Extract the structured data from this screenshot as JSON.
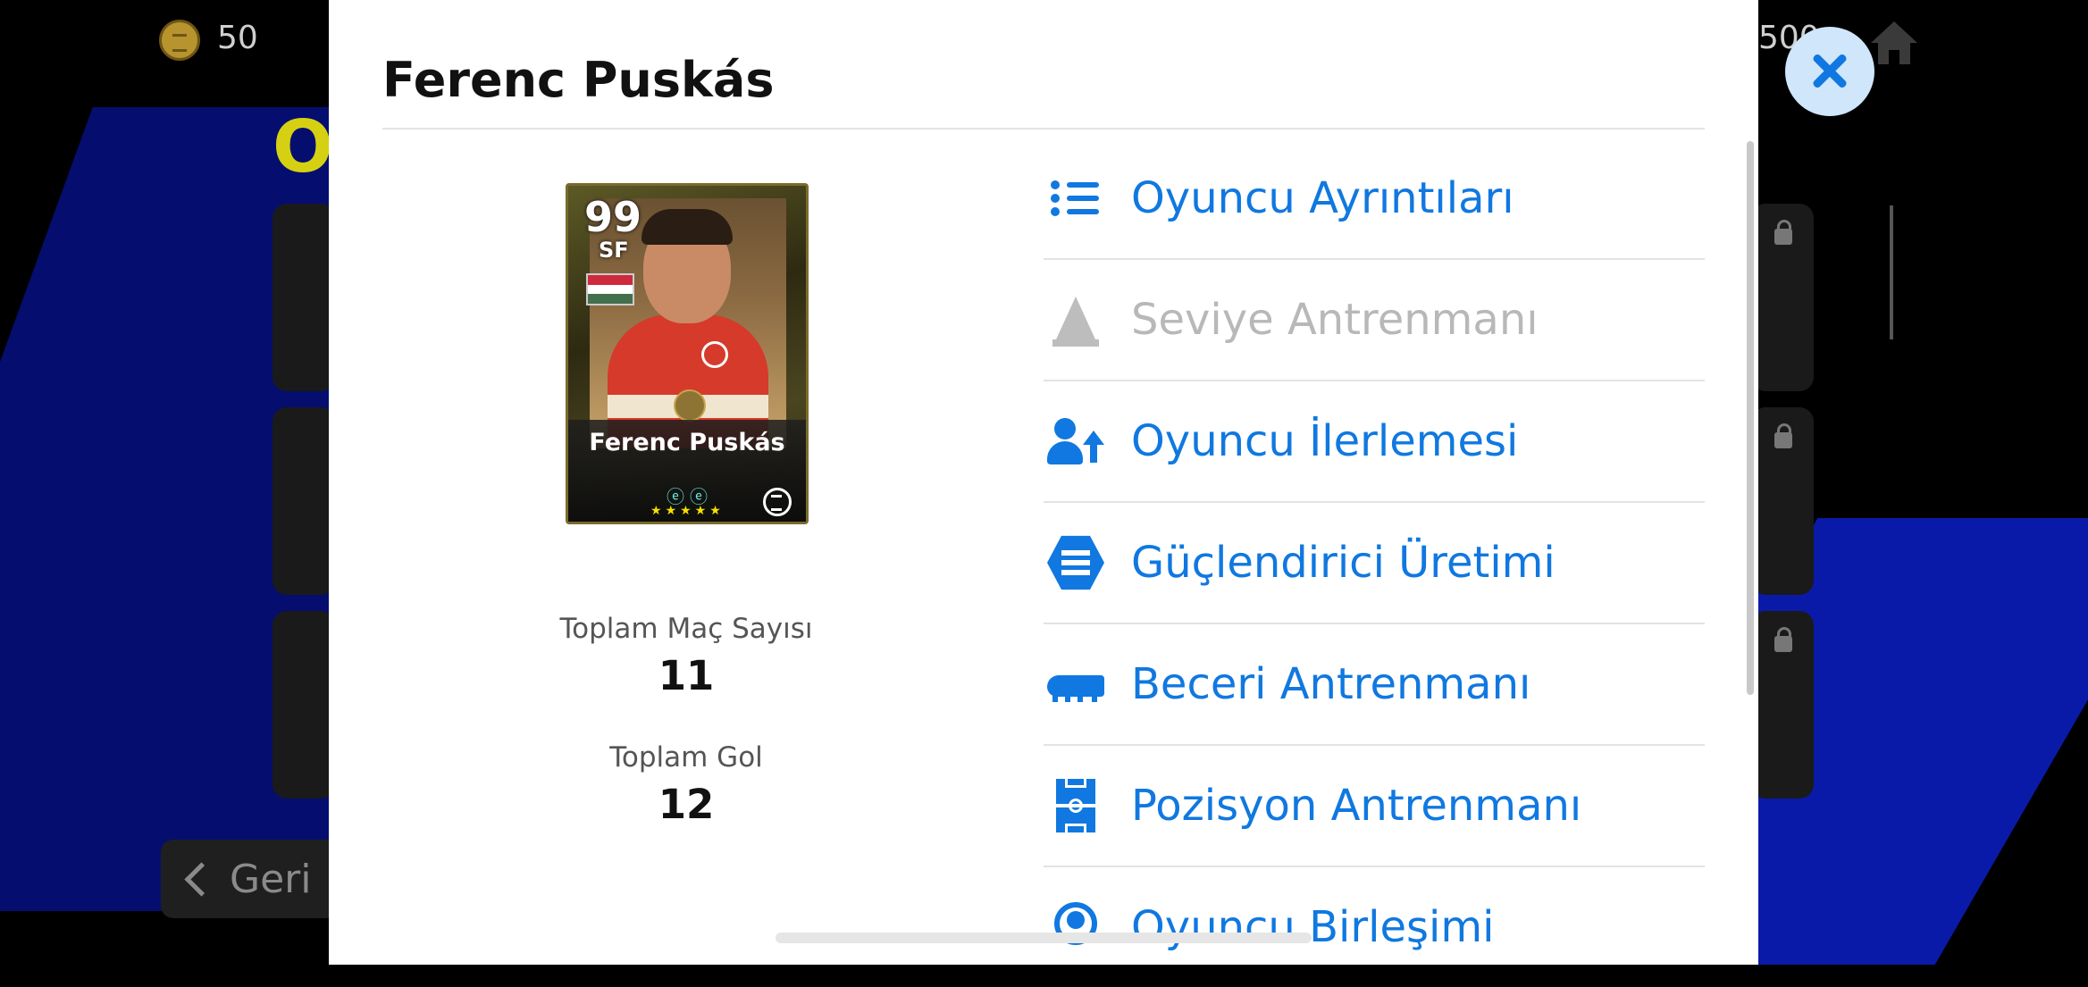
{
  "background": {
    "coin_amount": "50",
    "right_amount": "500",
    "title_fragment": "Oy",
    "back_label": "Geri"
  },
  "modal": {
    "title": "Ferenc Puskás",
    "card": {
      "rating": "99",
      "position": "SF",
      "name": "Ferenc Puskás",
      "skill_icons": "ⓔⓔ",
      "stars": "★★★★★"
    },
    "stats": [
      {
        "label": "Toplam Maç Sayısı",
        "value": "11"
      },
      {
        "label": "Toplam Gol",
        "value": "12"
      }
    ],
    "menu": [
      {
        "label": "Oyuncu Ayrıntıları",
        "icon": "list-icon",
        "enabled": true
      },
      {
        "label": "Seviye Antrenmanı",
        "icon": "cone-icon",
        "enabled": false
      },
      {
        "label": "Oyuncu İlerlemesi",
        "icon": "person-up-icon",
        "enabled": true
      },
      {
        "label": "Güçlendirici Üretimi",
        "icon": "efootball-hex-icon",
        "enabled": true
      },
      {
        "label": "Beceri Antrenmanı",
        "icon": "boot-icon",
        "enabled": true
      },
      {
        "label": "Pozisyon Antrenmanı",
        "icon": "pitch-icon",
        "enabled": true
      },
      {
        "label": "Oyuncu Birleşimi",
        "icon": "player-merge-icon",
        "enabled": true
      }
    ]
  },
  "colors": {
    "accent": "#1078e0",
    "disabled": "#b8b8b8",
    "close_bg": "#cfe6fb"
  }
}
